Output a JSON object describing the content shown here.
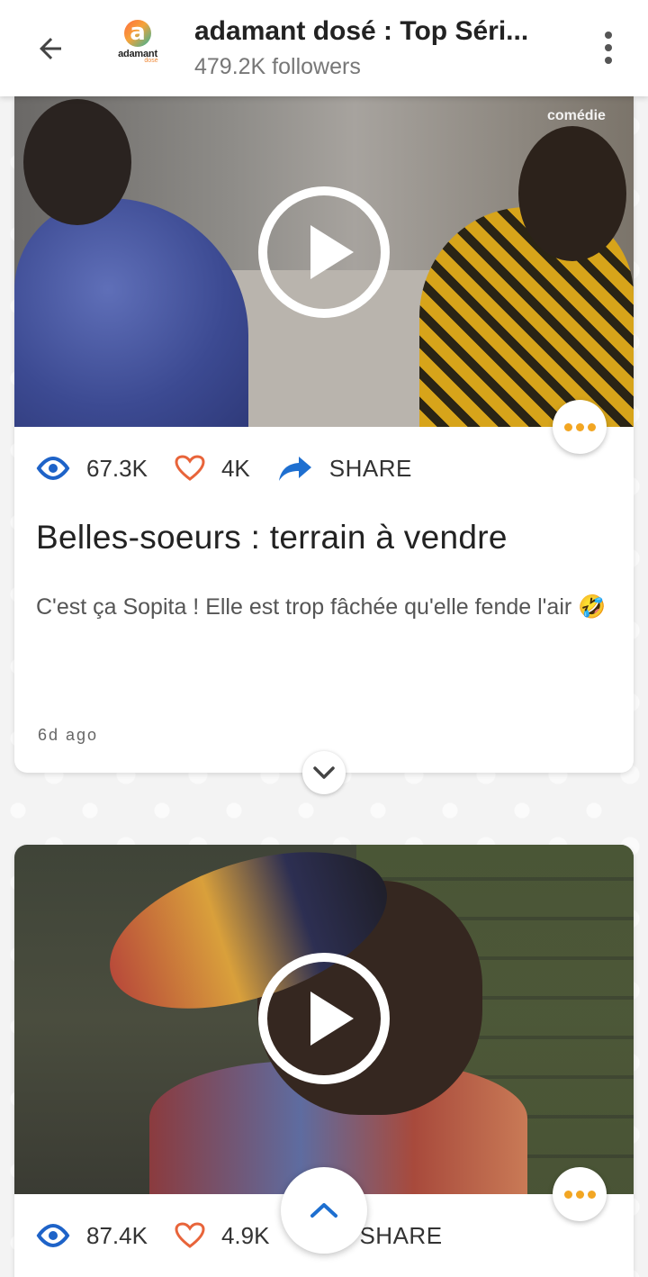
{
  "header": {
    "channel_title": "adamant dosé : Top Séri...",
    "followers": "479.2K followers",
    "logo_text": "adamant",
    "logo_sub": "dosé"
  },
  "colors": {
    "accent_orange": "#f2a623",
    "eye_blue": "#1e63c8",
    "heart_orange": "#e8643a",
    "share_blue": "#1e6fd0"
  },
  "posts": [
    {
      "thumb_label": "comédie",
      "views": "67.3K",
      "likes": "4K",
      "share_label": "SHARE",
      "title": "Belles-soeurs : terrain à vendre",
      "description": "C'est ça Sopita ! Elle est trop fâchée qu'elle fende l'air 🤣",
      "time": "6d ago"
    },
    {
      "views": "87.4K",
      "likes": "4.9K",
      "share_label": "SHARE"
    }
  ],
  "icons": {
    "back": "arrow-left-icon",
    "menu": "more-vertical-icon",
    "play": "play-icon",
    "views": "eye-icon",
    "likes": "heart-icon",
    "share": "share-arrow-icon",
    "more": "more-horizontal-icon",
    "expand": "chevron-down-icon",
    "scroll_top": "chevron-up-icon"
  }
}
